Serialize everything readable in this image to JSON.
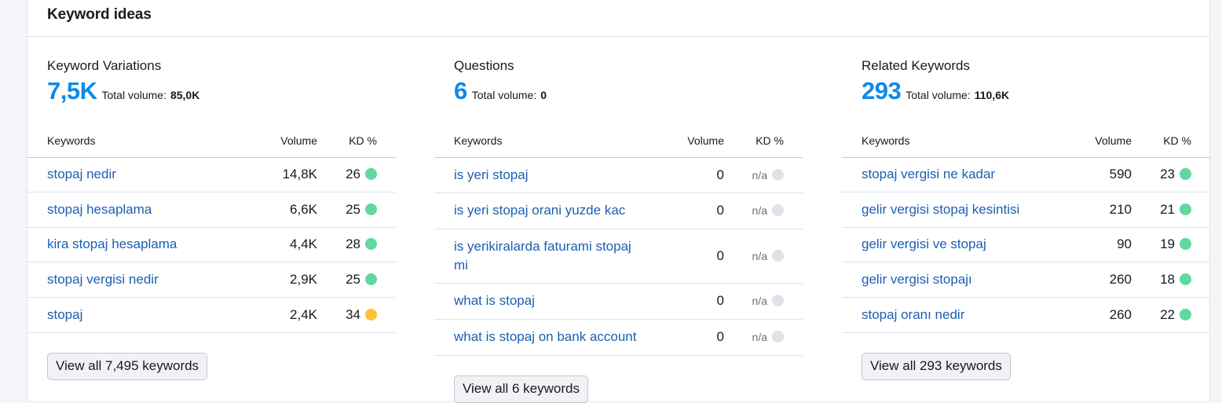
{
  "header": {
    "title": "Keyword ideas"
  },
  "col_headers": {
    "keywords": "Keywords",
    "volume": "Volume",
    "kd": "KD %"
  },
  "total_volume_label": "Total volume:",
  "colors": {
    "green": "#5fd99f",
    "yellow": "#ffc235",
    "gray": "#e0e1e9"
  },
  "columns": [
    {
      "title": "Keyword Variations",
      "count": "7,5K",
      "total_volume": "85,0K",
      "button": "View all 7,495 keywords",
      "rows": [
        {
          "keyword": "stopaj nedir",
          "volume": "14,8K",
          "kd": "26",
          "dot": "green"
        },
        {
          "keyword": "stopaj hesaplama",
          "volume": "6,6K",
          "kd": "25",
          "dot": "green"
        },
        {
          "keyword": "kira stopaj hesaplama",
          "volume": "4,4K",
          "kd": "28",
          "dot": "green"
        },
        {
          "keyword": "stopaj vergisi nedir",
          "volume": "2,9K",
          "kd": "25",
          "dot": "green"
        },
        {
          "keyword": "stopaj",
          "volume": "2,4K",
          "kd": "34",
          "dot": "yellow"
        }
      ]
    },
    {
      "title": "Questions",
      "count": "6",
      "total_volume": "0",
      "button": "View all 6 keywords",
      "rows": [
        {
          "keyword": "is yeri stopaj",
          "volume": "0",
          "kd": "n/a",
          "dot": "gray"
        },
        {
          "keyword": "is yeri stopaj orani yuzde kac",
          "volume": "0",
          "kd": "n/a",
          "dot": "gray"
        },
        {
          "keyword": "is yerikiralarda faturami stopaj mi",
          "volume": "0",
          "kd": "n/a",
          "dot": "gray"
        },
        {
          "keyword": "what is stopaj",
          "volume": "0",
          "kd": "n/a",
          "dot": "gray"
        },
        {
          "keyword": "what is stopaj on bank account",
          "volume": "0",
          "kd": "n/a",
          "dot": "gray"
        }
      ]
    },
    {
      "title": "Related Keywords",
      "count": "293",
      "total_volume": "110,6K",
      "button": "View all 293 keywords",
      "rows": [
        {
          "keyword": "stopaj vergisi ne kadar",
          "volume": "590",
          "kd": "23",
          "dot": "green"
        },
        {
          "keyword": "gelir vergisi stopaj kesintisi",
          "volume": "210",
          "kd": "21",
          "dot": "green"
        },
        {
          "keyword": "gelir vergisi ve stopaj",
          "volume": "90",
          "kd": "19",
          "dot": "green"
        },
        {
          "keyword": "gelir vergisi stopajı",
          "volume": "260",
          "kd": "18",
          "dot": "green"
        },
        {
          "keyword": "stopaj oranı nedir",
          "volume": "260",
          "kd": "22",
          "dot": "green"
        }
      ]
    }
  ]
}
